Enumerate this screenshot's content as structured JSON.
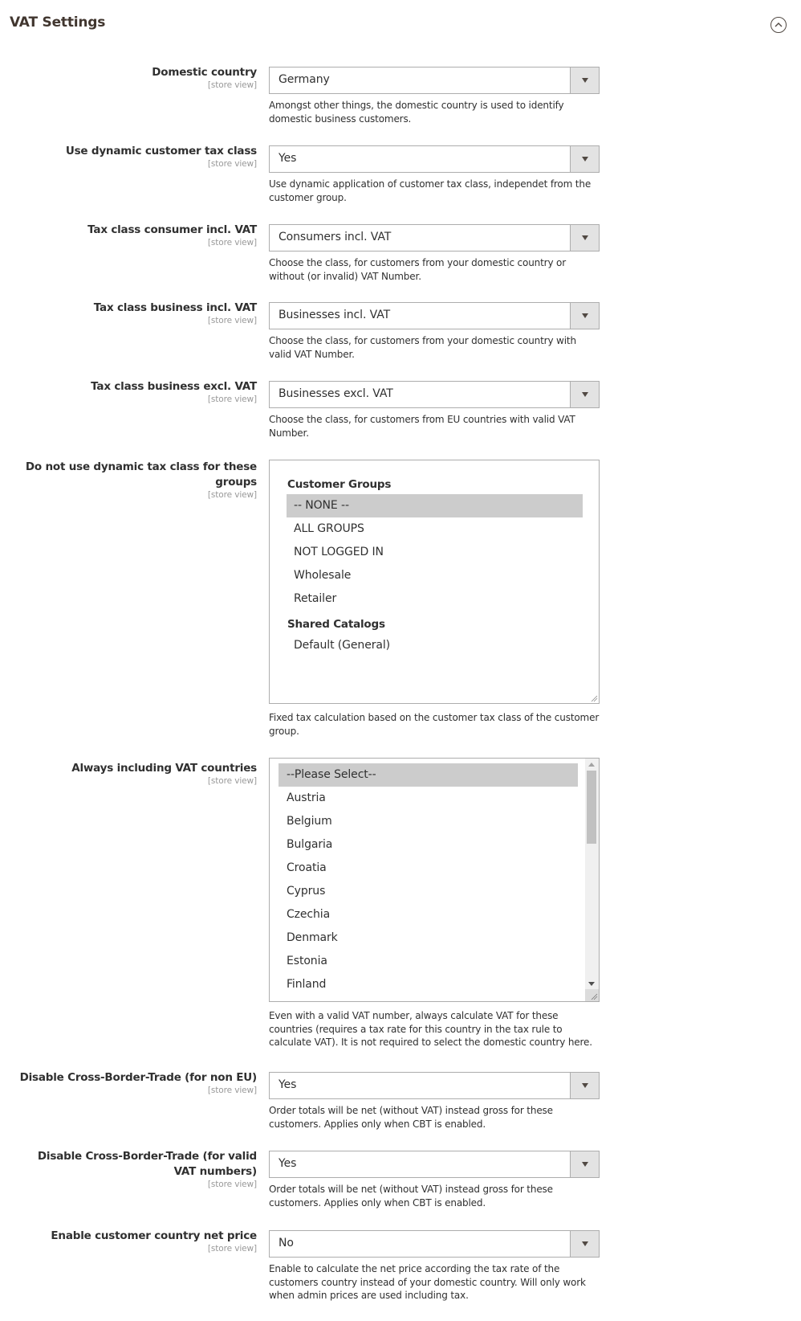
{
  "section": {
    "title": "VAT Settings",
    "collapse_icon": "chevron-up-circle-icon"
  },
  "fields": [
    {
      "label": "Domestic country",
      "scope": "[store view]",
      "value": "Germany",
      "note": "Amongst other things, the domestic country is used to identify domestic business customers."
    },
    {
      "label": "Use dynamic customer tax class",
      "scope": "[store view]",
      "value": "Yes",
      "note": "Use dynamic application of customer tax class, independet from the customer group."
    },
    {
      "label": "Tax class consumer incl. VAT",
      "scope": "[store view]",
      "value": "Consumers incl. VAT",
      "note": "Choose the class, for customers from your domestic country or without (or invalid) VAT Number."
    },
    {
      "label": "Tax class business incl. VAT",
      "scope": "[store view]",
      "value": "Businesses incl. VAT",
      "note": "Choose the class, for customers from your domestic country with valid VAT Number."
    },
    {
      "label": "Tax class business excl. VAT",
      "scope": "[store view]",
      "value": "Businesses excl. VAT",
      "note": "Choose the class, for customers from EU countries with valid VAT Number."
    }
  ],
  "exclude_groups": {
    "label": "Do not use dynamic tax class for these groups",
    "scope": "[store view]",
    "groups": [
      {
        "label": "Customer Groups",
        "options": [
          {
            "text": "-- NONE --",
            "selected": true
          },
          {
            "text": "ALL GROUPS",
            "selected": false
          },
          {
            "text": "NOT LOGGED IN",
            "selected": false
          },
          {
            "text": "Wholesale",
            "selected": false
          },
          {
            "text": "Retailer",
            "selected": false
          }
        ]
      },
      {
        "label": "Shared Catalogs",
        "options": [
          {
            "text": "Default (General)",
            "selected": false
          }
        ]
      }
    ],
    "note": "Fixed tax calculation based on the customer tax class of the customer group."
  },
  "vat_countries": {
    "label": "Always including VAT countries",
    "scope": "[store view]",
    "options": [
      {
        "text": "--Please Select--",
        "selected": true
      },
      {
        "text": "Austria",
        "selected": false
      },
      {
        "text": "Belgium",
        "selected": false
      },
      {
        "text": "Bulgaria",
        "selected": false
      },
      {
        "text": "Croatia",
        "selected": false
      },
      {
        "text": "Cyprus",
        "selected": false
      },
      {
        "text": "Czechia",
        "selected": false
      },
      {
        "text": "Denmark",
        "selected": false
      },
      {
        "text": "Estonia",
        "selected": false
      },
      {
        "text": "Finland",
        "selected": false
      }
    ],
    "note": "Even with a valid VAT number, always calculate VAT for these countries (requires a tax rate for this country in the tax rule to calculate VAT). It is not required to select the domestic country here."
  },
  "fields_bottom": [
    {
      "label": "Disable Cross-Border-Trade (for non EU)",
      "scope": "[store view]",
      "value": "Yes",
      "note": "Order totals will be net (without VAT) instead gross for these customers. Applies only when CBT is enabled."
    },
    {
      "label": "Disable Cross-Border-Trade (for valid VAT numbers)",
      "scope": "[store view]",
      "value": "Yes",
      "note": "Order totals will be net (without VAT) instead gross for these customers. Applies only when CBT is enabled."
    },
    {
      "label": "Enable customer country net price",
      "scope": "[store view]",
      "value": "No",
      "note": "Enable to calculate the net price according the tax rate of the customers country instead of your domestic country. Will only work when admin prices are used including tax."
    }
  ]
}
